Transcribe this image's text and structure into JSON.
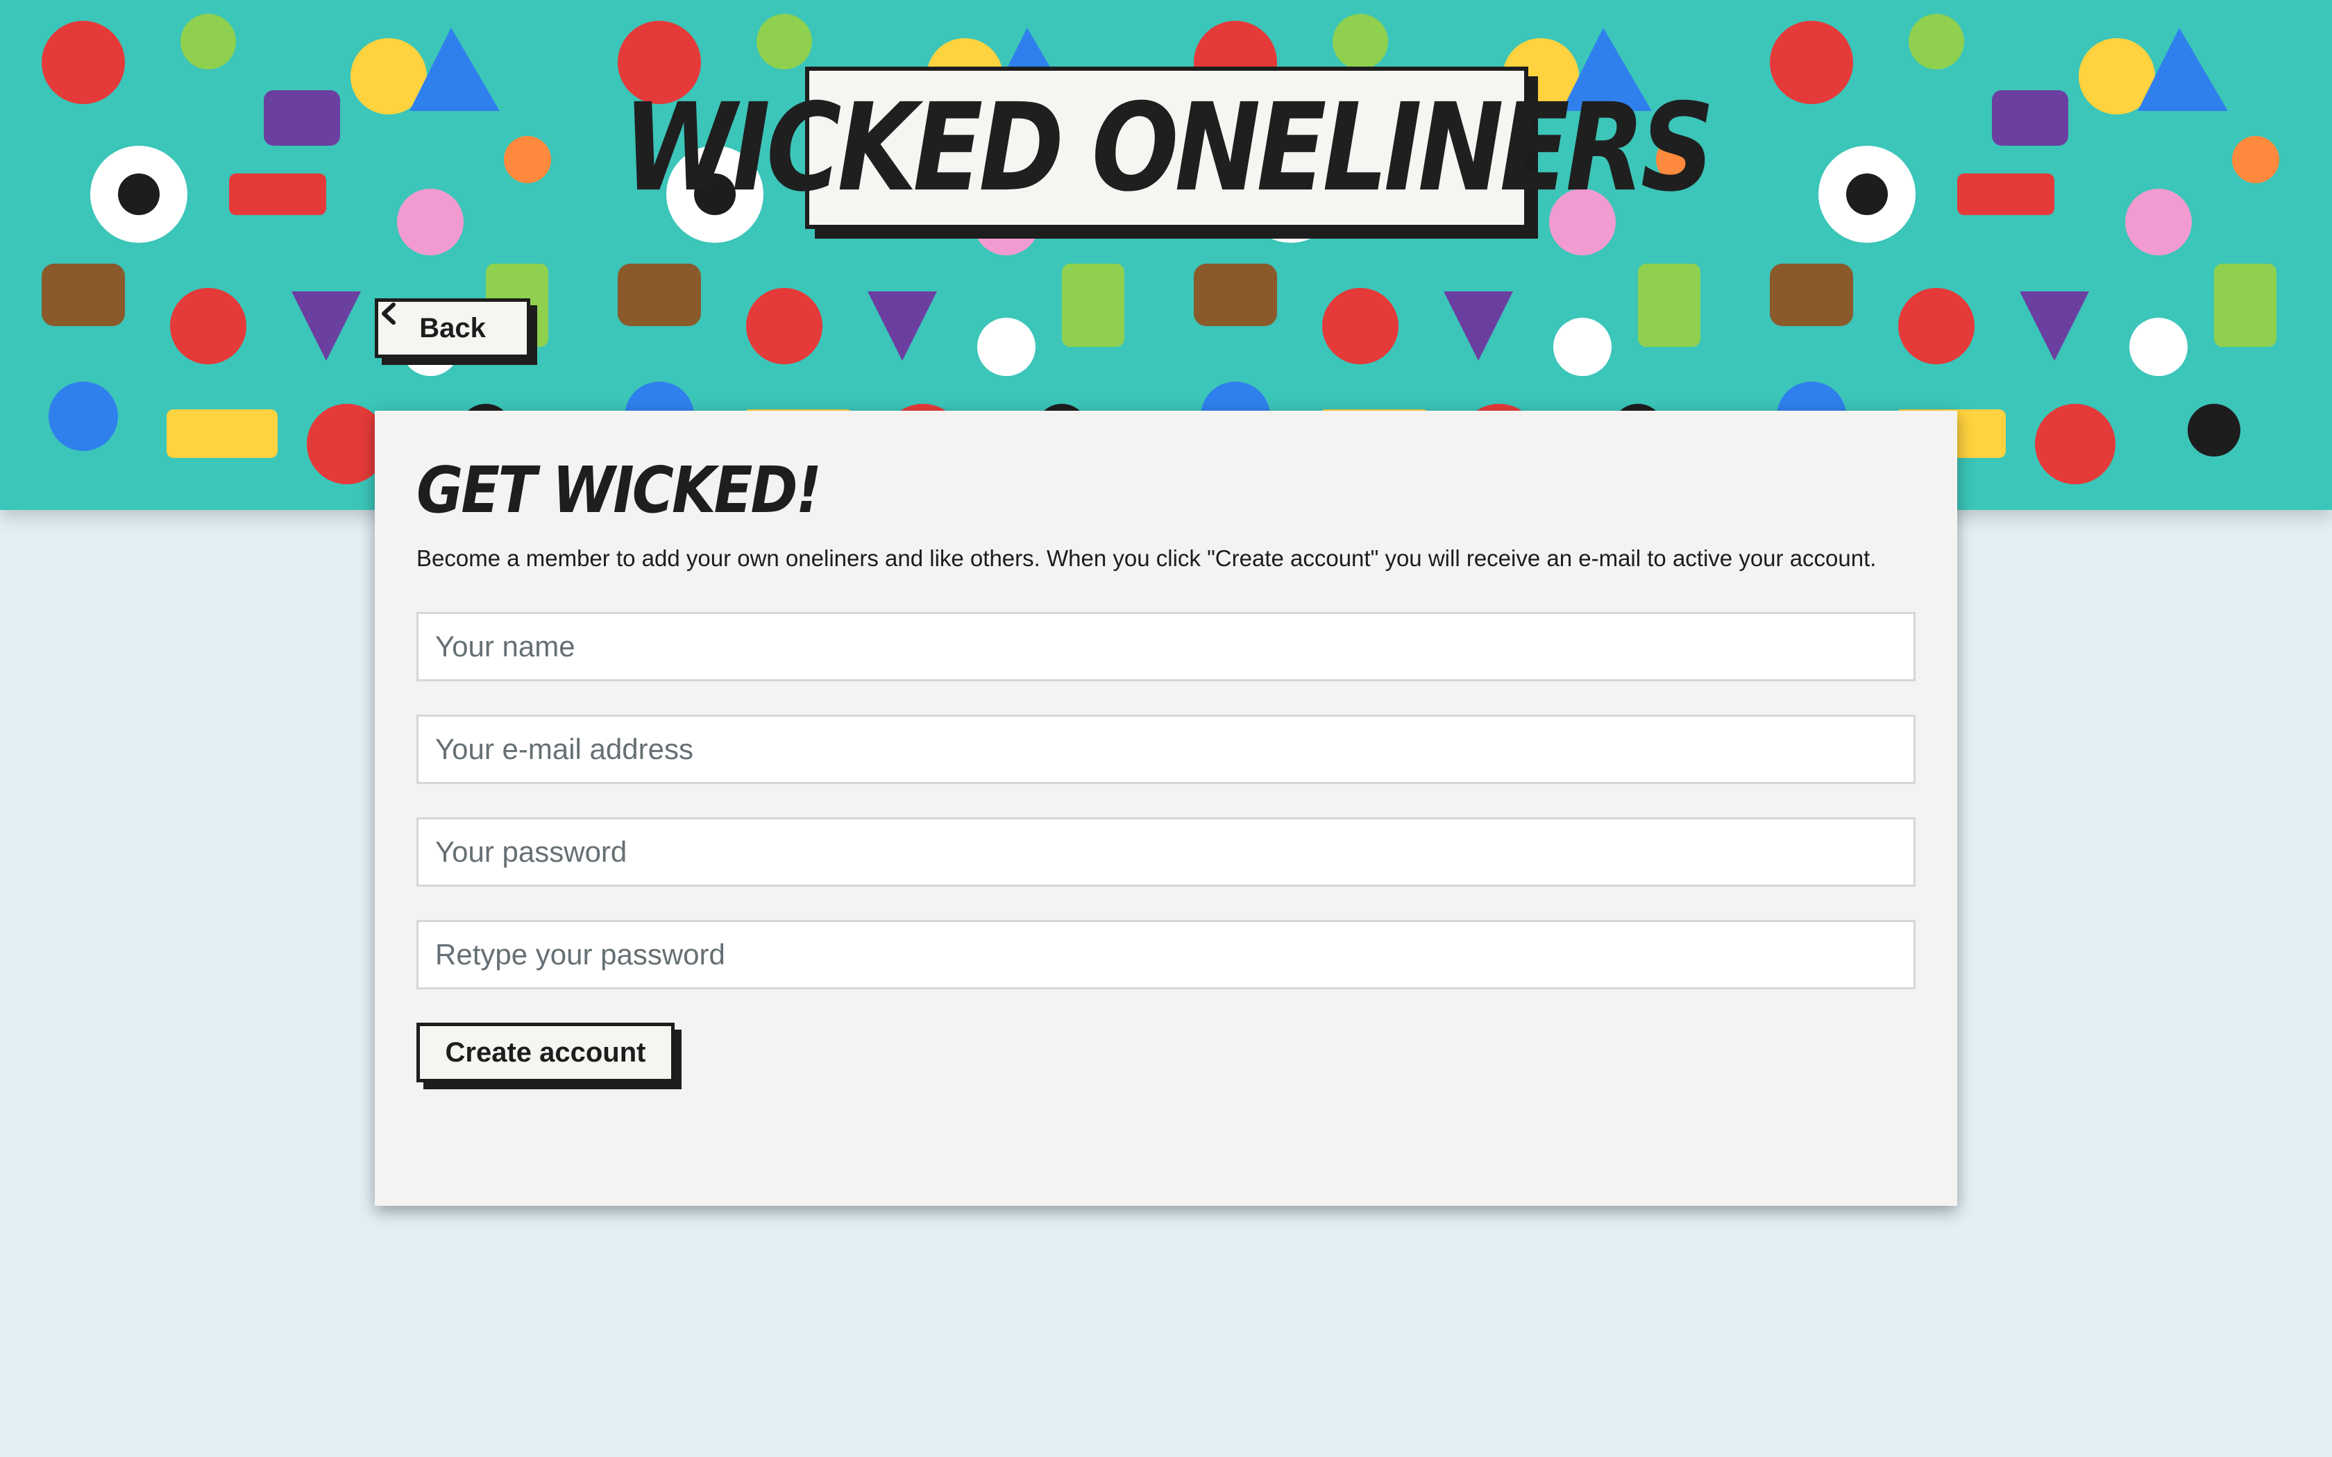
{
  "header": {
    "logo_text": "Wicked Oneliners",
    "back_label": "Back",
    "back_icon": "chevron-left-icon",
    "banner_bg_color": "#3cc5b9"
  },
  "form": {
    "title": "Get Wicked!",
    "description": "Become a member to add your own oneliners and like others. When you click \"Create account\" you will receive an e-mail to active your account.",
    "name_placeholder": "Your name",
    "email_placeholder": "Your e-mail address",
    "password_placeholder": "Your password",
    "retype_placeholder": "Retype your password",
    "submit_label": "Create account"
  },
  "colors": {
    "page_bg": "#e2eff5",
    "ink": "#1d1d1d",
    "paper": "#f4f3f1"
  }
}
